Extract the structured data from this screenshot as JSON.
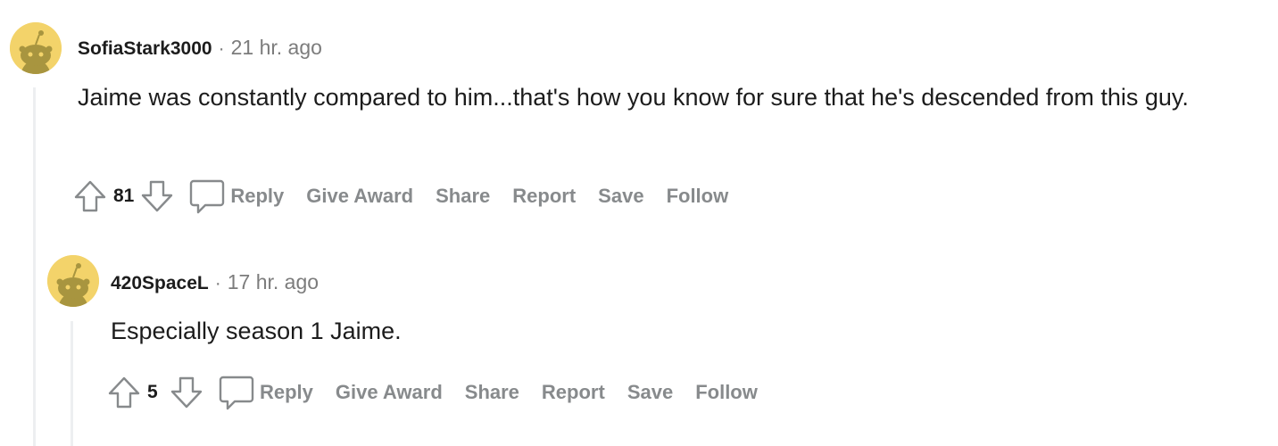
{
  "comments": [
    {
      "username": "SofiaStark3000",
      "separator": "·",
      "time": "21 hr. ago",
      "body": "Jaime was constantly compared to him...that's how you know for sure that he's descended from this guy.",
      "score": "81",
      "actions": {
        "reply": "Reply",
        "award": "Give Award",
        "share": "Share",
        "report": "Report",
        "save": "Save",
        "follow": "Follow"
      }
    },
    {
      "username": "420SpaceL",
      "separator": "·",
      "time": "17 hr. ago",
      "body": "Especially season 1 Jaime.",
      "score": "5",
      "actions": {
        "reply": "Reply",
        "award": "Give Award",
        "share": "Share",
        "report": "Report",
        "save": "Save",
        "follow": "Follow"
      }
    }
  ],
  "icons": {
    "avatar": "snoo-avatar-icon",
    "upvote": "upvote-arrow-icon",
    "downvote": "downvote-arrow-icon",
    "reply": "comment-bubble-icon"
  },
  "colors": {
    "avatar_bg": "#f3d36a",
    "avatar_figure": "#a8953f",
    "action_text": "#878a8c",
    "thread_line": "#edeff1"
  }
}
